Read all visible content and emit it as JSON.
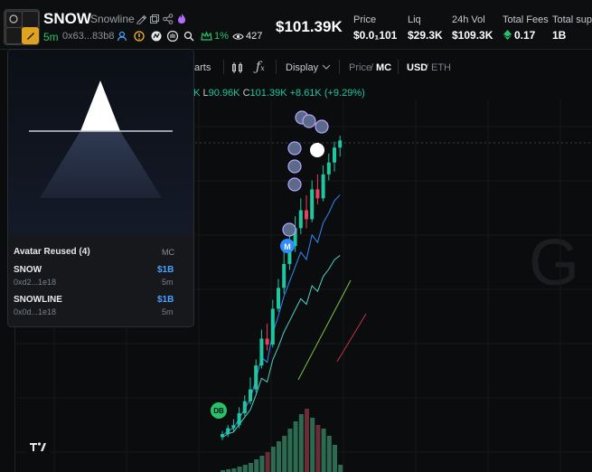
{
  "header": {
    "ticker": "SNOW",
    "name": "Snowline",
    "age": "5m",
    "address": "0x63...83b8",
    "holders_pct": "1%",
    "views": "427",
    "price_big": "$101.39K",
    "stats": [
      {
        "label": "Price",
        "value": "$0.0₁101"
      },
      {
        "label": "Liq",
        "value": "$29.3K"
      },
      {
        "label": "24h Vol",
        "value": "$109.3K"
      },
      {
        "label": "Total Fees",
        "value": "0.17"
      },
      {
        "label": "Total supp",
        "value": "1B"
      }
    ],
    "icons": [
      "edit-icon",
      "copy-icon",
      "share-icon",
      "fire-icon",
      "user-icon",
      "warning-icon",
      "search-icon",
      "crown-icon",
      "eye-icon"
    ]
  },
  "toolbar": {
    "charts_label": "arts",
    "display_label": "Display",
    "price_label": "Price",
    "mc_label": "MC",
    "usd_label": "USD",
    "eth_label": "ETH"
  },
  "ohlc": {
    "h_partial": "6K",
    "l_label": "L",
    "l_value": "90.96K",
    "c_label": "C",
    "c_value": "101.39K",
    "change": "+8.61K (+9.29%)"
  },
  "popup": {
    "title": "Avatar Reused (4)",
    "mc_header": "MC",
    "rows": [
      {
        "name": "SNOW",
        "address": "0xd2...1e18",
        "mc": "$1B",
        "age": "5m"
      },
      {
        "name": "SNOWLINE",
        "address": "0x0d...1e18",
        "mc": "$1B",
        "age": "5m"
      }
    ]
  },
  "chart_data": {
    "type": "candlestick",
    "markers": [
      "DB",
      "M"
    ],
    "watermark": "G",
    "colors": {
      "up": "#1fc7a0",
      "down": "#f03c5a",
      "vol_up": "#2c6b52",
      "vol_down": "#6b2c36"
    },
    "candles": [
      {
        "o": 2,
        "c": 3,
        "h": 4,
        "l": 1
      },
      {
        "o": 3,
        "c": 5,
        "h": 6,
        "l": 2
      },
      {
        "o": 5,
        "c": 6,
        "h": 8,
        "l": 4
      },
      {
        "o": 6,
        "c": 10,
        "h": 12,
        "l": 5
      },
      {
        "o": 10,
        "c": 14,
        "h": 16,
        "l": 9
      },
      {
        "o": 14,
        "c": 18,
        "h": 22,
        "l": 13
      },
      {
        "o": 18,
        "c": 26,
        "h": 28,
        "l": 17
      },
      {
        "o": 26,
        "c": 35,
        "h": 38,
        "l": 25
      },
      {
        "o": 35,
        "c": 33,
        "h": 40,
        "l": 31
      },
      {
        "o": 33,
        "c": 45,
        "h": 48,
        "l": 32
      },
      {
        "o": 45,
        "c": 52,
        "h": 55,
        "l": 44
      },
      {
        "o": 52,
        "c": 60,
        "h": 65,
        "l": 50
      },
      {
        "o": 60,
        "c": 66,
        "h": 70,
        "l": 58
      },
      {
        "o": 66,
        "c": 72,
        "h": 76,
        "l": 64
      },
      {
        "o": 72,
        "c": 78,
        "h": 82,
        "l": 70
      },
      {
        "o": 78,
        "c": 75,
        "h": 83,
        "l": 72
      },
      {
        "o": 75,
        "c": 85,
        "h": 88,
        "l": 74
      },
      {
        "o": 85,
        "c": 82,
        "h": 90,
        "l": 80
      },
      {
        "o": 82,
        "c": 90,
        "h": 93,
        "l": 81
      },
      {
        "o": 90,
        "c": 94,
        "h": 97,
        "l": 88
      },
      {
        "o": 94,
        "c": 99,
        "h": 101,
        "l": 91
      },
      {
        "o": 99,
        "c": 101.39,
        "h": 103,
        "l": 96
      }
    ],
    "volumes": [
      2,
      3,
      4,
      6,
      8,
      10,
      14,
      18,
      22,
      28,
      34,
      40,
      48,
      56,
      64,
      70,
      60,
      52,
      48,
      40,
      30,
      8
    ]
  }
}
